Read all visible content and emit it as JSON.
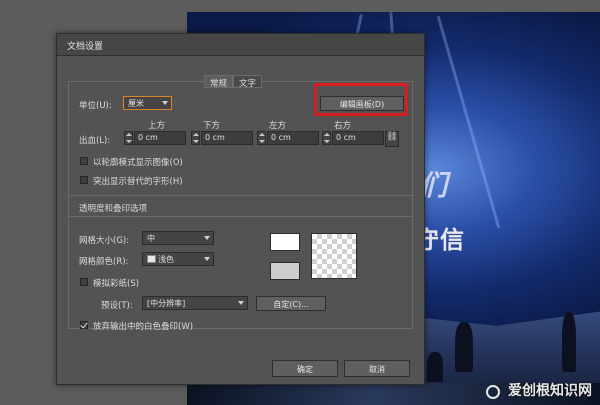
{
  "artwork": {
    "title_text": "们",
    "subtitle_text": "守信",
    "watermark": "爱创根知识网"
  },
  "dialog": {
    "title": "文档设置",
    "tabs": [
      "常规",
      "文字"
    ],
    "unit_label": "单位(U):",
    "unit_value": "厘米",
    "edit_artboard_button": "编辑画板(D)",
    "bleed_label": "出血(L):",
    "bleed": {
      "top_label": "上方",
      "top_value": "0 cm",
      "bottom_label": "下方",
      "bottom_value": "0 cm",
      "left_label": "左方",
      "left_value": "0 cm",
      "right_label": "右方",
      "right_value": "0 cm"
    },
    "chain_icon": "link-icon",
    "outline_mode_label": "以轮廓模式显示图像(O)",
    "highlight_glyphs_label": "突出显示替代的字形(H)",
    "transparency_section": "透明度和叠印选项",
    "grid_size_label": "网格大小(G):",
    "grid_size_value": "中",
    "grid_color_label": "网格颜色(R):",
    "grid_color_value": "浅色",
    "simulate_paper_label": "模拟彩纸(S)",
    "preset_label": "预设(T):",
    "preset_value": "[中分辨率]",
    "custom_button": "自定(C)...",
    "discard_white_overprint_label": "放弃输出中的白色叠印(W)",
    "ok_button": "确定",
    "cancel_button": "取消"
  },
  "colors": {
    "highlight_box": "#d81f1f",
    "dialog_bg": "#535353",
    "unit_dropdown_border": "#d9832a"
  }
}
